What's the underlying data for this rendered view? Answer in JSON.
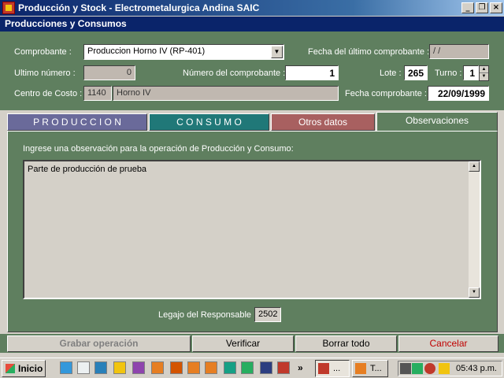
{
  "window": {
    "title": "Producción y Stock - Electrometalurgica Andina SAIC",
    "minimize": "_",
    "maximize": "❐",
    "close": "×"
  },
  "form_title": "Producciones y Consumos",
  "header": {
    "comprobante_label": "Comprobante :",
    "comprobante_value": "Produccion Horno IV (RP-401)",
    "fecha_ultimo_label": "Fecha del último comprobante :",
    "fecha_ultimo_value": "/   /",
    "ultimo_numero_label": "Ultimo número :",
    "ultimo_numero_value": "0",
    "numero_label": "Número del comprobante :",
    "numero_value": "1",
    "lote_label": "Lote :",
    "lote_value": "265",
    "turno_label": "Turno :",
    "turno_value": "1",
    "centro_label": "Centro de Costo :",
    "centro_code": "1140",
    "centro_name": "Horno  IV",
    "fecha_comp_label": "Fecha comprobante :",
    "fecha_comp_value": "22/09/1999"
  },
  "tabs": [
    {
      "label": "P R O D U C C I O N",
      "color": "#6a6a9a"
    },
    {
      "label": "C O N S U M O",
      "color": "#207878"
    },
    {
      "label": "Otros datos",
      "color": "#a86060"
    },
    {
      "label": "Observaciones",
      "color": "#5f7f5f"
    }
  ],
  "observaciones": {
    "prompt": "Ingrese una observación para la operación de Producción y Consumo:",
    "text": "Parte de producción de prueba",
    "legajo_label": "Legajo del Responsable :",
    "legajo_value": "2502"
  },
  "actions": {
    "grabar": "Grabar operación",
    "verificar": "Verificar",
    "borrar": "Borrar todo",
    "cancelar": "Cancelar"
  },
  "taskbar": {
    "start": "Inicio",
    "more": "»",
    "task1": "...",
    "task2": "T...",
    "clock": "05:43 p.m."
  }
}
